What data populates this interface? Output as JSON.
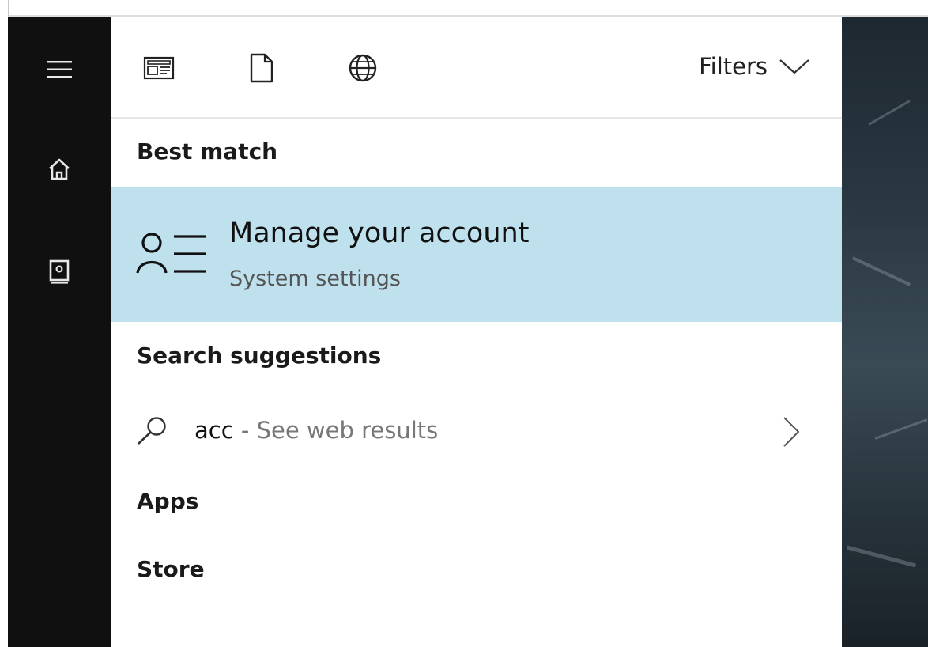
{
  "toolbar": {
    "filters_label": "Filters",
    "icons": [
      "news-icon",
      "document-icon",
      "globe-icon",
      "chevron-down-icon"
    ]
  },
  "rail": {
    "items": [
      {
        "icon": "hamburger-menu-icon"
      },
      {
        "icon": "home-icon"
      },
      {
        "icon": "notebook-icon"
      }
    ]
  },
  "best_match": {
    "header": "Best match",
    "title": "Manage your account",
    "subtitle": "System settings",
    "icon": "account-settings-icon",
    "highlight_color": "#bfe1ee"
  },
  "search_suggestions": {
    "header": "Search suggestions",
    "item": {
      "query": "acc",
      "separator": "-",
      "detail": "See web results",
      "icon": "search-icon",
      "chevron": "chevron-right-icon"
    }
  },
  "categories": {
    "apps": "Apps",
    "store": "Store"
  }
}
